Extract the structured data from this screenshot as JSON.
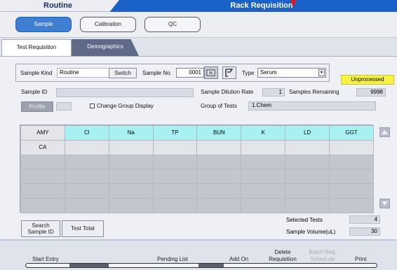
{
  "titlebar": {
    "left_title": "Routine",
    "right_title": "Rack Requisition"
  },
  "categories": [
    {
      "label": "Sample",
      "active": true
    },
    {
      "label": "Calibration",
      "active": false
    },
    {
      "label": "QC",
      "active": false
    }
  ],
  "tabs": [
    {
      "label": "Test Requisition",
      "active": true
    },
    {
      "label": "Demographics",
      "active": false
    }
  ],
  "form": {
    "sample_kind_label": "Sample Kind",
    "sample_kind_value": "Routine",
    "switch_label": "Switch",
    "sample_no_label": "Sample No.",
    "sample_no_value": "0001",
    "type_label": "Type",
    "type_value": "Serum",
    "status_badge": "Unprocessed",
    "sample_id_label": "Sample ID",
    "sample_id_value": "",
    "dilution_label": "Sample Dilution Rate",
    "dilution_value": "1",
    "remaining_label": "Samples Remaining",
    "remaining_value": "9998",
    "profile_label": "Profile",
    "change_group_label": "Change Group Display",
    "group_label": "Group of Tests",
    "group_value": "1.Chem"
  },
  "grid": {
    "header_row": [
      "AMY",
      "Cl",
      "Na",
      "TP",
      "BUN",
      "K",
      "LD",
      "GGT"
    ],
    "row2": [
      "CA",
      "",
      "",
      "",
      "",
      "",
      "",
      ""
    ]
  },
  "summary": {
    "selected_label": "Selected Tests",
    "selected_value": "4",
    "volume_label": "Sample Volume(uL)",
    "volume_value": "30"
  },
  "buttons": {
    "search_line1": "Search",
    "search_line2": "Sample ID",
    "test_total": "Test Total"
  },
  "bottombar": {
    "start_entry": "Start Entry",
    "pending_list": "Pending List",
    "add_on": "Add On",
    "delete_line1": "Delete",
    "delete_line2": "Requisition",
    "batch_line1": "Batch Req.",
    "batch_line2": "Sched.ule",
    "print": "Print"
  },
  "colors": {
    "accent": "#1a62c8",
    "active_button": "#3f7fd3",
    "status_yellow": "#f7f340",
    "cyan_cell": "#a8f1f1"
  }
}
